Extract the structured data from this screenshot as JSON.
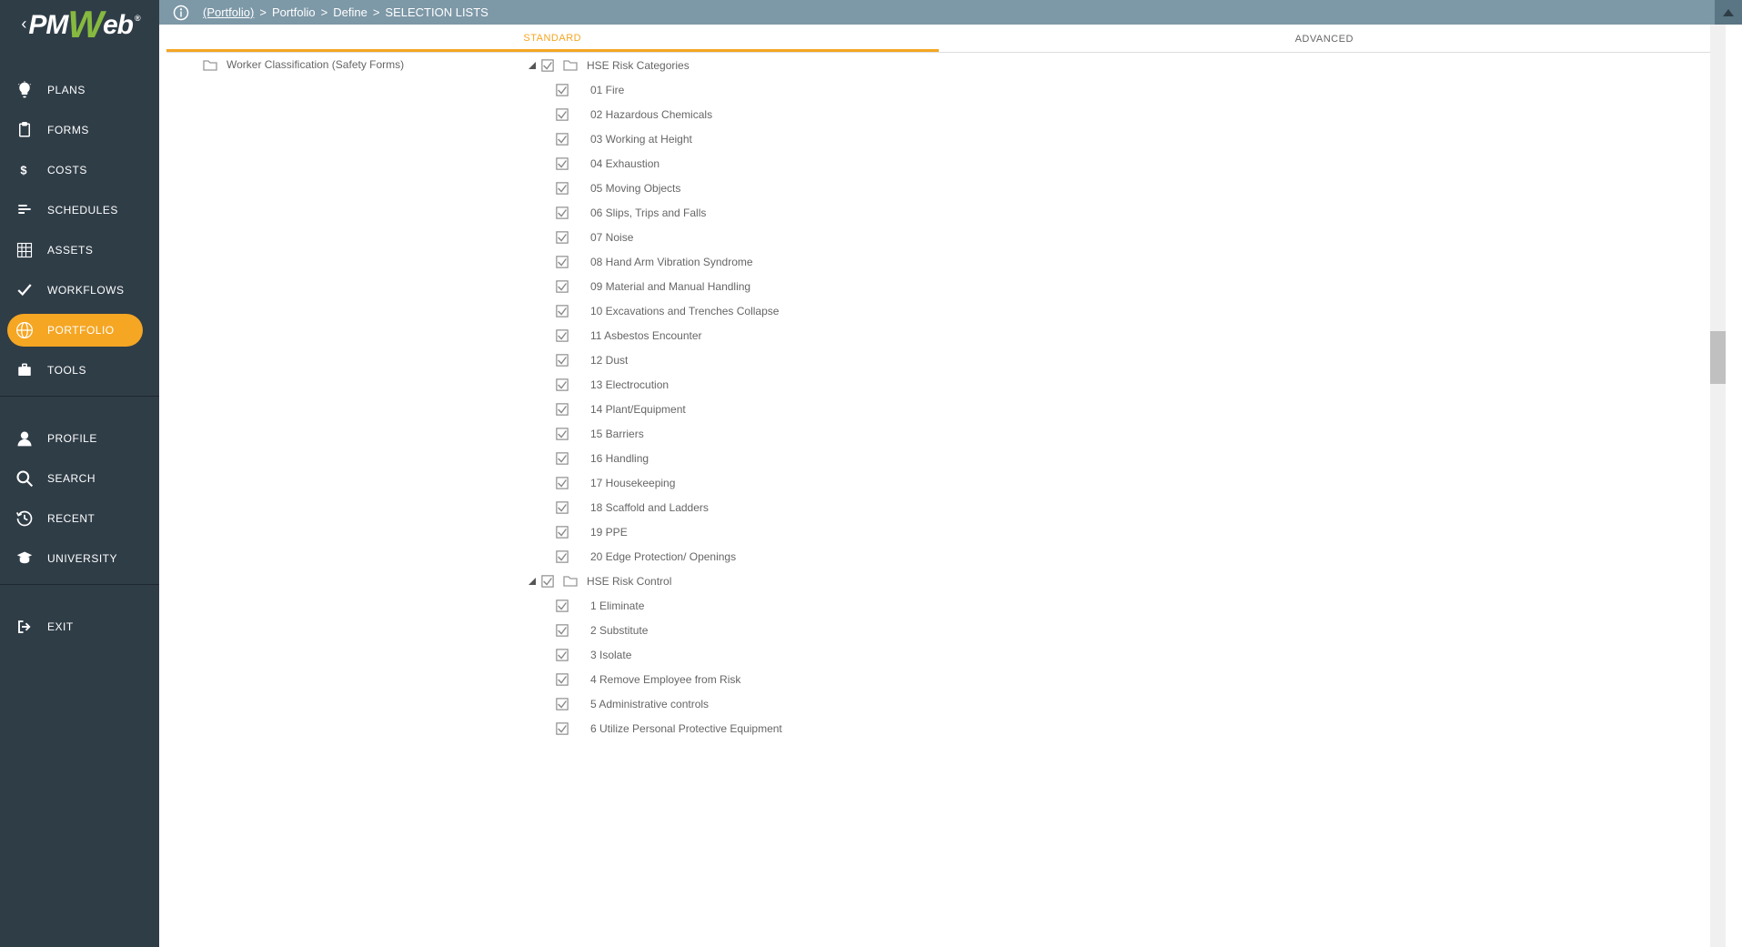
{
  "breadcrumb": {
    "root_link": "(Portfolio)",
    "parts": [
      "Portfolio",
      "Define",
      "SELECTION LISTS"
    ]
  },
  "sidebar": {
    "items": [
      {
        "label": "PLANS",
        "icon": "bulb"
      },
      {
        "label": "FORMS",
        "icon": "clipboard"
      },
      {
        "label": "COSTS",
        "icon": "dollar"
      },
      {
        "label": "SCHEDULES",
        "icon": "bars"
      },
      {
        "label": "ASSETS",
        "icon": "grid"
      },
      {
        "label": "WORKFLOWS",
        "icon": "check"
      },
      {
        "label": "PORTFOLIO",
        "icon": "globe",
        "active": true
      },
      {
        "label": "TOOLS",
        "icon": "briefcase"
      }
    ],
    "items2": [
      {
        "label": "PROFILE",
        "icon": "person"
      },
      {
        "label": "SEARCH",
        "icon": "search"
      },
      {
        "label": "RECENT",
        "icon": "history"
      },
      {
        "label": "UNIVERSITY",
        "icon": "grad"
      }
    ],
    "items3": [
      {
        "label": "EXIT",
        "icon": "exit"
      }
    ]
  },
  "tabs": {
    "standard": "STANDARD",
    "advanced": "ADVANCED"
  },
  "left_tree": {
    "worker_classification": "Worker Classification (Safety Forms)"
  },
  "categories": [
    {
      "name": "HSE Risk Categories",
      "items": [
        "01 Fire",
        "02 Hazardous Chemicals",
        "03 Working at Height",
        "04 Exhaustion",
        "05 Moving Objects",
        "06 Slips, Trips and Falls",
        "07 Noise",
        "08 Hand Arm Vibration Syndrome",
        "09 Material and Manual Handling",
        "10 Excavations and Trenches Collapse",
        "11 Asbestos Encounter",
        "12 Dust",
        "13 Electrocution",
        "14 Plant/Equipment",
        "15 Barriers",
        "16 Handling",
        "17 Housekeeping",
        "18 Scaffold and Ladders",
        "19 PPE",
        "20 Edge Protection/ Openings"
      ]
    },
    {
      "name": "HSE Risk Control",
      "items": [
        "1 Eliminate",
        "2 Substitute",
        "3 Isolate",
        "4 Remove Employee from Risk",
        "5 Administrative controls",
        "6 Utilize Personal Protective Equipment"
      ]
    }
  ]
}
